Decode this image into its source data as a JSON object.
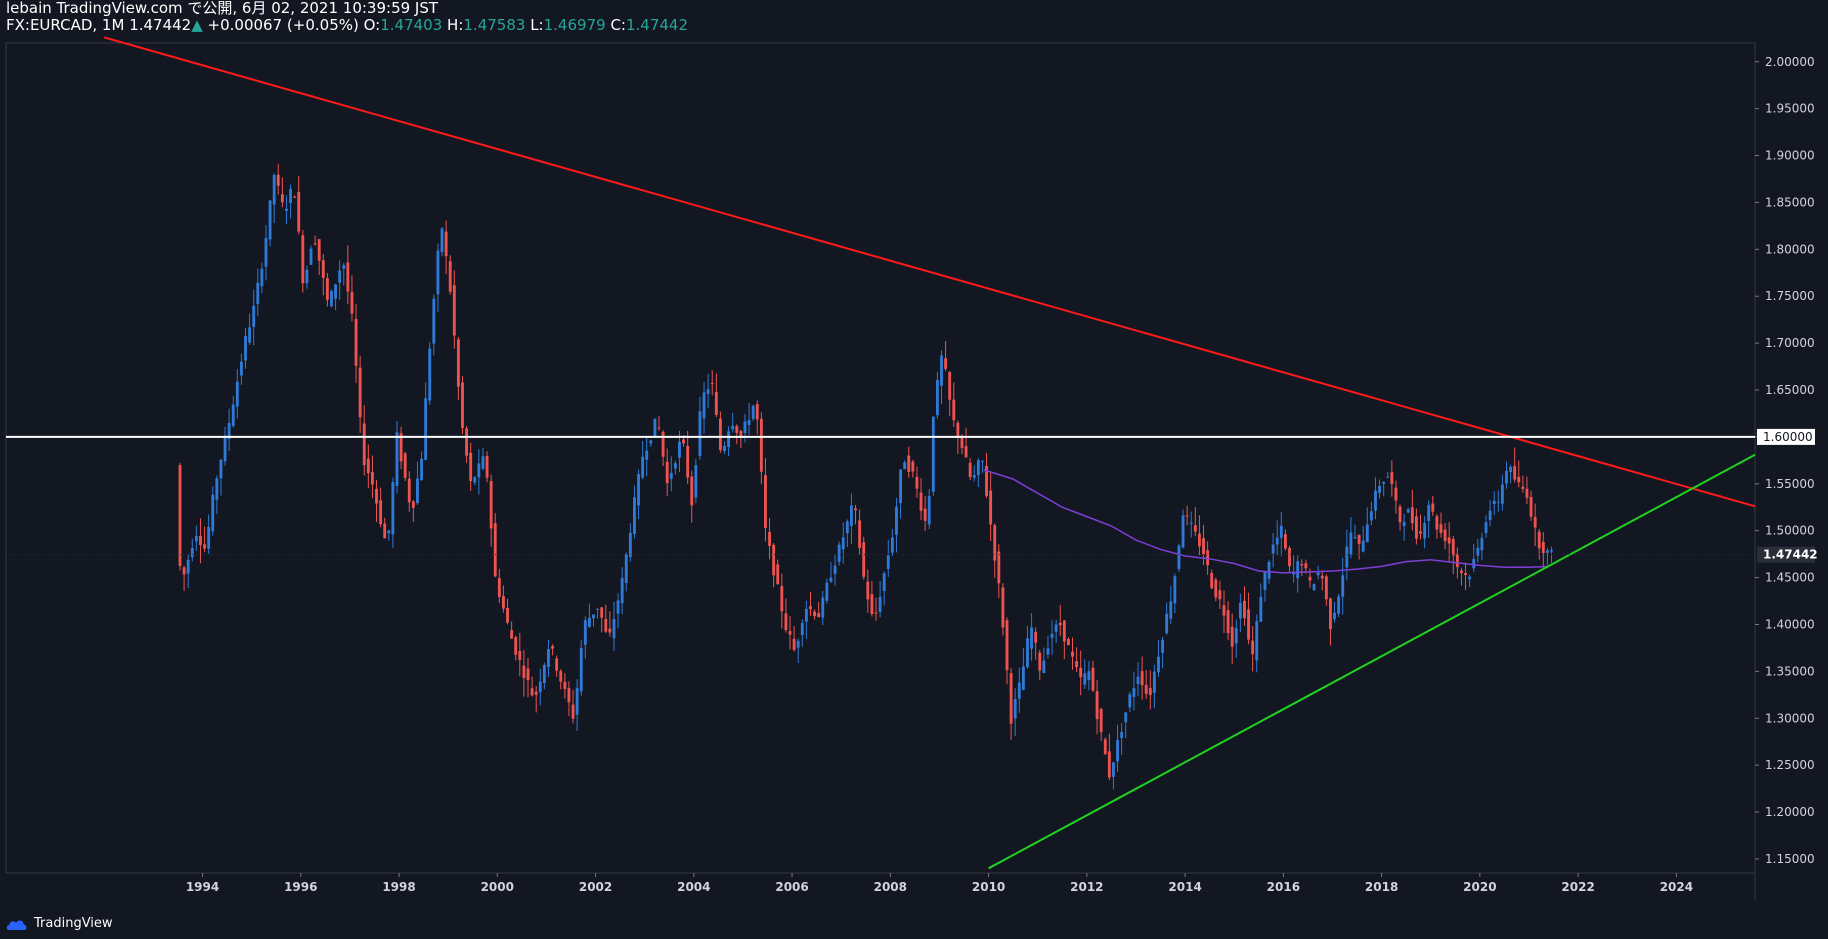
{
  "header": {
    "line1": "lebain TradingView.com で公開, 6月 02, 2021 10:39:59 JST",
    "symbol_interval": "FX:EURCAD, 1M",
    "last_price": "1.47442",
    "change": "+0.00067 (+0.05%)",
    "o_label": "O:",
    "o_value": "1.47403",
    "h_label": "H:",
    "h_value": "1.47583",
    "l_label": "L:",
    "l_value": "1.46979",
    "c_label": "C:",
    "c_value": "1.47442"
  },
  "footer": {
    "brand": "TradingView"
  },
  "colors": {
    "background": "#131722",
    "bull": "#2e7ad6",
    "bear": "#ef5350",
    "resistance": "#ff1a1a",
    "support": "#1fd31f",
    "level": "#ffffff",
    "ma": "#7e3fd6",
    "axis_text": "#d1d4dc",
    "accent_up": "#26a69a"
  },
  "chart_data": {
    "type": "candlestick",
    "symbol": "FX:EURCAD",
    "interval": "1M",
    "x_axis": {
      "type": "time",
      "range": [
        1990.0,
        2025.6
      ],
      "ticks": [
        "1994",
        "1996",
        "1998",
        "2000",
        "2002",
        "2004",
        "2006",
        "2008",
        "2010",
        "2012",
        "2014",
        "2016",
        "2018",
        "2020",
        "2022",
        "2024"
      ]
    },
    "y_axis": {
      "range": [
        1.135,
        2.02
      ],
      "position": "right",
      "ticks": [
        "1.15000",
        "1.20000",
        "1.25000",
        "1.30000",
        "1.35000",
        "1.40000",
        "1.45000",
        "1.50000",
        "1.55000",
        "1.60000",
        "1.65000",
        "1.70000",
        "1.75000",
        "1.80000",
        "1.85000",
        "1.90000",
        "1.95000",
        "2.00000"
      ]
    },
    "price_path": [
      [
        1993.5,
        1.57
      ],
      [
        1993.6,
        1.44
      ],
      [
        1993.9,
        1.5
      ],
      [
        1994.1,
        1.48
      ],
      [
        1994.3,
        1.55
      ],
      [
        1994.6,
        1.62
      ],
      [
        1994.9,
        1.7
      ],
      [
        1995.1,
        1.74
      ],
      [
        1995.3,
        1.8
      ],
      [
        1995.5,
        1.88
      ],
      [
        1995.7,
        1.84
      ],
      [
        1995.9,
        1.87
      ],
      [
        1996.1,
        1.76
      ],
      [
        1996.3,
        1.82
      ],
      [
        1996.6,
        1.74
      ],
      [
        1996.9,
        1.79
      ],
      [
        1997.1,
        1.72
      ],
      [
        1997.3,
        1.58
      ],
      [
        1997.5,
        1.55
      ],
      [
        1997.8,
        1.48
      ],
      [
        1998.0,
        1.6
      ],
      [
        1998.3,
        1.52
      ],
      [
        1998.5,
        1.58
      ],
      [
        1998.7,
        1.72
      ],
      [
        1998.9,
        1.83
      ],
      [
        1999.1,
        1.75
      ],
      [
        1999.3,
        1.62
      ],
      [
        1999.5,
        1.55
      ],
      [
        1999.8,
        1.58
      ],
      [
        2000.0,
        1.45
      ],
      [
        2000.3,
        1.39
      ],
      [
        2000.5,
        1.36
      ],
      [
        2000.8,
        1.32
      ],
      [
        2001.1,
        1.38
      ],
      [
        2001.4,
        1.33
      ],
      [
        2001.6,
        1.3
      ],
      [
        2001.8,
        1.4
      ],
      [
        2002.1,
        1.42
      ],
      [
        2002.3,
        1.38
      ],
      [
        2002.6,
        1.45
      ],
      [
        2002.8,
        1.52
      ],
      [
        2003.0,
        1.58
      ],
      [
        2003.3,
        1.62
      ],
      [
        2003.5,
        1.55
      ],
      [
        2003.8,
        1.6
      ],
      [
        2004.0,
        1.53
      ],
      [
        2004.2,
        1.64
      ],
      [
        2004.4,
        1.66
      ],
      [
        2004.6,
        1.58
      ],
      [
        2004.8,
        1.62
      ],
      [
        2005.0,
        1.6
      ],
      [
        2005.3,
        1.64
      ],
      [
        2005.5,
        1.5
      ],
      [
        2005.7,
        1.45
      ],
      [
        2005.9,
        1.4
      ],
      [
        2006.1,
        1.37
      ],
      [
        2006.3,
        1.42
      ],
      [
        2006.6,
        1.41
      ],
      [
        2006.8,
        1.45
      ],
      [
        2007.0,
        1.48
      ],
      [
        2007.3,
        1.53
      ],
      [
        2007.5,
        1.45
      ],
      [
        2007.7,
        1.4
      ],
      [
        2007.9,
        1.45
      ],
      [
        2008.1,
        1.5
      ],
      [
        2008.3,
        1.58
      ],
      [
        2008.5,
        1.56
      ],
      [
        2008.8,
        1.5
      ],
      [
        2008.9,
        1.62
      ],
      [
        2009.1,
        1.69
      ],
      [
        2009.3,
        1.62
      ],
      [
        2009.5,
        1.59
      ],
      [
        2009.7,
        1.55
      ],
      [
        2009.9,
        1.58
      ],
      [
        2010.1,
        1.5
      ],
      [
        2010.3,
        1.42
      ],
      [
        2010.5,
        1.3
      ],
      [
        2010.7,
        1.34
      ],
      [
        2010.9,
        1.4
      ],
      [
        2011.1,
        1.35
      ],
      [
        2011.3,
        1.39
      ],
      [
        2011.5,
        1.4
      ],
      [
        2011.7,
        1.37
      ],
      [
        2011.9,
        1.34
      ],
      [
        2012.1,
        1.35
      ],
      [
        2012.3,
        1.29
      ],
      [
        2012.5,
        1.24
      ],
      [
        2012.7,
        1.28
      ],
      [
        2012.9,
        1.32
      ],
      [
        2013.1,
        1.35
      ],
      [
        2013.3,
        1.32
      ],
      [
        2013.5,
        1.37
      ],
      [
        2013.8,
        1.44
      ],
      [
        2014.0,
        1.52
      ],
      [
        2014.2,
        1.5
      ],
      [
        2014.4,
        1.48
      ],
      [
        2014.6,
        1.44
      ],
      [
        2014.8,
        1.42
      ],
      [
        2015.0,
        1.38
      ],
      [
        2015.2,
        1.43
      ],
      [
        2015.4,
        1.36
      ],
      [
        2015.6,
        1.44
      ],
      [
        2015.8,
        1.48
      ],
      [
        2016.0,
        1.5
      ],
      [
        2016.2,
        1.45
      ],
      [
        2016.4,
        1.47
      ],
      [
        2016.6,
        1.44
      ],
      [
        2016.8,
        1.46
      ],
      [
        2017.0,
        1.4
      ],
      [
        2017.2,
        1.44
      ],
      [
        2017.4,
        1.5
      ],
      [
        2017.6,
        1.48
      ],
      [
        2017.8,
        1.52
      ],
      [
        2018.0,
        1.55
      ],
      [
        2018.2,
        1.56
      ],
      [
        2018.4,
        1.51
      ],
      [
        2018.6,
        1.52
      ],
      [
        2018.8,
        1.49
      ],
      [
        2019.0,
        1.53
      ],
      [
        2019.2,
        1.5
      ],
      [
        2019.4,
        1.49
      ],
      [
        2019.6,
        1.46
      ],
      [
        2019.8,
        1.45
      ],
      [
        2020.0,
        1.48
      ],
      [
        2020.2,
        1.52
      ],
      [
        2020.4,
        1.53
      ],
      [
        2020.6,
        1.57
      ],
      [
        2020.8,
        1.55
      ],
      [
        2021.0,
        1.54
      ],
      [
        2021.2,
        1.49
      ],
      [
        2021.45,
        1.4744
      ]
    ],
    "moving_average": [
      [
        2009.9,
        1.565
      ],
      [
        2010.5,
        1.555
      ],
      [
        2011.0,
        1.54
      ],
      [
        2011.5,
        1.525
      ],
      [
        2012.0,
        1.515
      ],
      [
        2012.5,
        1.505
      ],
      [
        2013.0,
        1.49
      ],
      [
        2013.5,
        1.48
      ],
      [
        2014.0,
        1.473
      ],
      [
        2014.5,
        1.47
      ],
      [
        2015.0,
        1.465
      ],
      [
        2015.5,
        1.457
      ],
      [
        2016.0,
        1.455
      ],
      [
        2016.5,
        1.456
      ],
      [
        2017.0,
        1.457
      ],
      [
        2017.5,
        1.459
      ],
      [
        2018.0,
        1.462
      ],
      [
        2018.5,
        1.467
      ],
      [
        2019.0,
        1.469
      ],
      [
        2019.5,
        1.466
      ],
      [
        2020.0,
        1.463
      ],
      [
        2020.5,
        1.461
      ],
      [
        2021.0,
        1.461
      ],
      [
        2021.4,
        1.462
      ]
    ],
    "trendlines": [
      {
        "kind": "resistance",
        "p1": [
          1992.0,
          2.026
        ],
        "p2": [
          2025.6,
          1.526
        ]
      },
      {
        "kind": "support",
        "p1": [
          2010.0,
          1.14
        ],
        "p2": [
          2025.6,
          1.581
        ]
      }
    ],
    "horizontal_levels": [
      1.6
    ],
    "price_labels": [
      "1.60000",
      "1.47442"
    ],
    "last_value": 1.47442
  }
}
